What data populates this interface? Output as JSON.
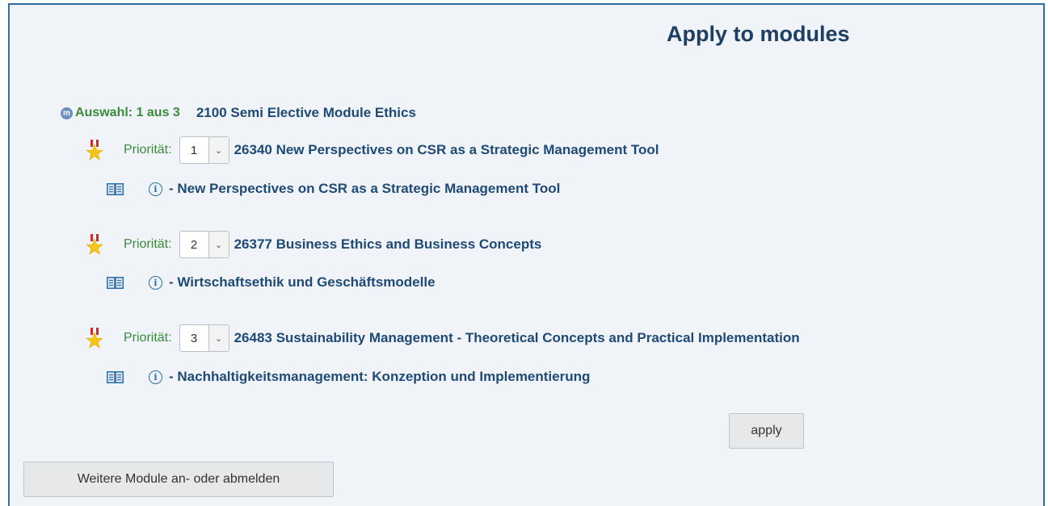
{
  "page": {
    "title": "Apply to modules"
  },
  "group": {
    "icon": "module-m-icon",
    "icon_glyph": "m",
    "selection_text": "Auswahl: 1 aus 3",
    "title": "2100 Semi Elective Module Ethics"
  },
  "modules": [
    {
      "priority_label": "Priorität:",
      "priority_value": "1",
      "title": "26340 New Perspectives on CSR as a Strategic Management Tool",
      "detail": "- New Perspectives on CSR as a Strategic Management Tool"
    },
    {
      "priority_label": "Priorität:",
      "priority_value": "2",
      "title": "26377 Business Ethics and Business Concepts",
      "detail": "- Wirtschaftsethik und Geschäftsmodelle"
    },
    {
      "priority_label": "Priorität:",
      "priority_value": "3",
      "title": "26483 Sustainability Management - Theoretical Concepts and Practical Implementation",
      "detail": "- Nachhaltigkeitsmanagement: Konzeption und Implementierung"
    }
  ],
  "icons": {
    "priority": "priority-star-icon",
    "book": "book-icon",
    "info": "info-icon",
    "info_glyph": "i",
    "select_arrow": "⌄"
  },
  "buttons": {
    "apply": "apply",
    "more_modules": "Weitere Module an- oder abmelden"
  },
  "colors": {
    "panel_border": "#2f6ea5",
    "panel_bg": "#f0f4f8",
    "title": "#1f3f62",
    "link": "#1f4a75",
    "green": "#3a8a3a",
    "star": "#f5c518",
    "star_ribbon": "#d42a2a"
  }
}
